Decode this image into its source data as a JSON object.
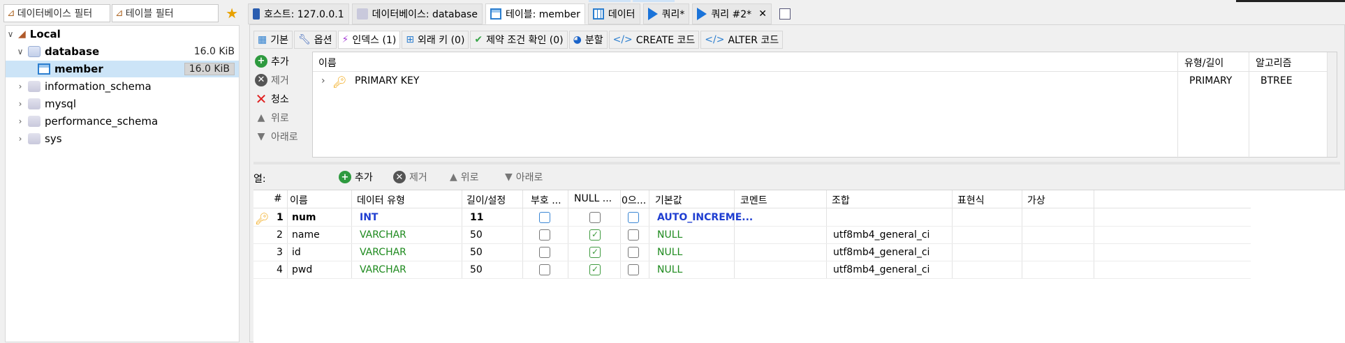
{
  "filters": {
    "database_filter": "데이터베이스 필터",
    "table_filter": "테이블 필터",
    "favorite_icon": "star-icon"
  },
  "tree": {
    "root": "Local",
    "database": "database",
    "database_size": "16.0 KiB",
    "member": "member",
    "member_size": "16.0 KiB",
    "others": [
      "information_schema",
      "mysql",
      "performance_schema",
      "sys"
    ]
  },
  "top_tabs": {
    "host": "호스트: 127.0.0.1",
    "database": "데이터베이스: database",
    "table": "테이블: member",
    "data": "데이터",
    "query1": "쿼리*",
    "query2": "쿼리 #2*",
    "close": "✕"
  },
  "sub_tabs": {
    "basic": "기본",
    "options": "옵션",
    "indexes": "인덱스 (1)",
    "foreign_keys": "외래 키 (0)",
    "check": "제약 조건 확인 (0)",
    "partition": "분할",
    "create_code": "CREATE 코드",
    "alter_code": "ALTER 코드"
  },
  "index_buttons": {
    "add": "추가",
    "remove": "제거",
    "clear": "청소",
    "up": "위로",
    "down": "아래로"
  },
  "index_table": {
    "headers": {
      "name": "이름",
      "type_length": "유형/길이",
      "algorithm": "알고리즘"
    },
    "rows": [
      {
        "name": "PRIMARY KEY",
        "type": "PRIMARY",
        "algorithm": "BTREE"
      }
    ]
  },
  "columns_bar": {
    "label": "열:",
    "add": "추가",
    "remove": "제거",
    "up": "위로",
    "down": "아래로"
  },
  "columns_table": {
    "headers": {
      "num": "#",
      "name": "이름",
      "datatype": "데이터 유형",
      "length": "길이/설정",
      "unsigned": "부호 ...",
      "null": "NULL ...",
      "zerofill": "0으...",
      "default": "기본값",
      "comment": "코멘트",
      "collation": "조합",
      "expression": "표현식",
      "virtual": "가상"
    },
    "rows": [
      {
        "num": "1",
        "name": "num",
        "datatype": "INT",
        "length": "11",
        "unsigned": false,
        "allow_null": false,
        "zerofill": false,
        "default": "AUTO_INCREME...",
        "comment": "",
        "collation": "",
        "primary": true
      },
      {
        "num": "2",
        "name": "name",
        "datatype": "VARCHAR",
        "length": "50",
        "unsigned": false,
        "allow_null": true,
        "zerofill": false,
        "default": "NULL",
        "comment": "",
        "collation": "utf8mb4_general_ci",
        "primary": false
      },
      {
        "num": "3",
        "name": "id",
        "datatype": "VARCHAR",
        "length": "50",
        "unsigned": false,
        "allow_null": true,
        "zerofill": false,
        "default": "NULL",
        "comment": "",
        "collation": "utf8mb4_general_ci",
        "primary": false
      },
      {
        "num": "4",
        "name": "pwd",
        "datatype": "VARCHAR",
        "length": "50",
        "unsigned": false,
        "allow_null": true,
        "zerofill": false,
        "default": "NULL",
        "comment": "",
        "collation": "utf8mb4_general_ci",
        "primary": false
      }
    ]
  },
  "colors": {
    "accent_blue": "#1f3ed1",
    "type_green": "#1e8a1e",
    "selection": "#cce4f7",
    "key_gold": "#f0a000"
  }
}
